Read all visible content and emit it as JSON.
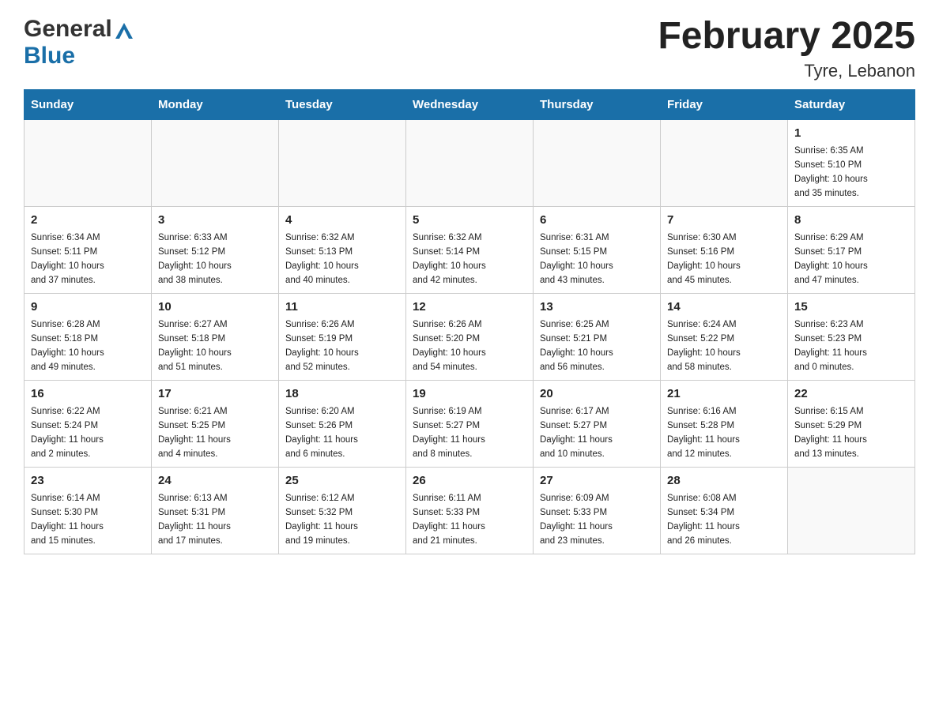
{
  "logo": {
    "general": "General",
    "blue": "Blue"
  },
  "title": "February 2025",
  "subtitle": "Tyre, Lebanon",
  "weekdays": [
    "Sunday",
    "Monday",
    "Tuesday",
    "Wednesday",
    "Thursday",
    "Friday",
    "Saturday"
  ],
  "weeks": [
    [
      {
        "day": "",
        "info": ""
      },
      {
        "day": "",
        "info": ""
      },
      {
        "day": "",
        "info": ""
      },
      {
        "day": "",
        "info": ""
      },
      {
        "day": "",
        "info": ""
      },
      {
        "day": "",
        "info": ""
      },
      {
        "day": "1",
        "info": "Sunrise: 6:35 AM\nSunset: 5:10 PM\nDaylight: 10 hours\nand 35 minutes."
      }
    ],
    [
      {
        "day": "2",
        "info": "Sunrise: 6:34 AM\nSunset: 5:11 PM\nDaylight: 10 hours\nand 37 minutes."
      },
      {
        "day": "3",
        "info": "Sunrise: 6:33 AM\nSunset: 5:12 PM\nDaylight: 10 hours\nand 38 minutes."
      },
      {
        "day": "4",
        "info": "Sunrise: 6:32 AM\nSunset: 5:13 PM\nDaylight: 10 hours\nand 40 minutes."
      },
      {
        "day": "5",
        "info": "Sunrise: 6:32 AM\nSunset: 5:14 PM\nDaylight: 10 hours\nand 42 minutes."
      },
      {
        "day": "6",
        "info": "Sunrise: 6:31 AM\nSunset: 5:15 PM\nDaylight: 10 hours\nand 43 minutes."
      },
      {
        "day": "7",
        "info": "Sunrise: 6:30 AM\nSunset: 5:16 PM\nDaylight: 10 hours\nand 45 minutes."
      },
      {
        "day": "8",
        "info": "Sunrise: 6:29 AM\nSunset: 5:17 PM\nDaylight: 10 hours\nand 47 minutes."
      }
    ],
    [
      {
        "day": "9",
        "info": "Sunrise: 6:28 AM\nSunset: 5:18 PM\nDaylight: 10 hours\nand 49 minutes."
      },
      {
        "day": "10",
        "info": "Sunrise: 6:27 AM\nSunset: 5:18 PM\nDaylight: 10 hours\nand 51 minutes."
      },
      {
        "day": "11",
        "info": "Sunrise: 6:26 AM\nSunset: 5:19 PM\nDaylight: 10 hours\nand 52 minutes."
      },
      {
        "day": "12",
        "info": "Sunrise: 6:26 AM\nSunset: 5:20 PM\nDaylight: 10 hours\nand 54 minutes."
      },
      {
        "day": "13",
        "info": "Sunrise: 6:25 AM\nSunset: 5:21 PM\nDaylight: 10 hours\nand 56 minutes."
      },
      {
        "day": "14",
        "info": "Sunrise: 6:24 AM\nSunset: 5:22 PM\nDaylight: 10 hours\nand 58 minutes."
      },
      {
        "day": "15",
        "info": "Sunrise: 6:23 AM\nSunset: 5:23 PM\nDaylight: 11 hours\nand 0 minutes."
      }
    ],
    [
      {
        "day": "16",
        "info": "Sunrise: 6:22 AM\nSunset: 5:24 PM\nDaylight: 11 hours\nand 2 minutes."
      },
      {
        "day": "17",
        "info": "Sunrise: 6:21 AM\nSunset: 5:25 PM\nDaylight: 11 hours\nand 4 minutes."
      },
      {
        "day": "18",
        "info": "Sunrise: 6:20 AM\nSunset: 5:26 PM\nDaylight: 11 hours\nand 6 minutes."
      },
      {
        "day": "19",
        "info": "Sunrise: 6:19 AM\nSunset: 5:27 PM\nDaylight: 11 hours\nand 8 minutes."
      },
      {
        "day": "20",
        "info": "Sunrise: 6:17 AM\nSunset: 5:27 PM\nDaylight: 11 hours\nand 10 minutes."
      },
      {
        "day": "21",
        "info": "Sunrise: 6:16 AM\nSunset: 5:28 PM\nDaylight: 11 hours\nand 12 minutes."
      },
      {
        "day": "22",
        "info": "Sunrise: 6:15 AM\nSunset: 5:29 PM\nDaylight: 11 hours\nand 13 minutes."
      }
    ],
    [
      {
        "day": "23",
        "info": "Sunrise: 6:14 AM\nSunset: 5:30 PM\nDaylight: 11 hours\nand 15 minutes."
      },
      {
        "day": "24",
        "info": "Sunrise: 6:13 AM\nSunset: 5:31 PM\nDaylight: 11 hours\nand 17 minutes."
      },
      {
        "day": "25",
        "info": "Sunrise: 6:12 AM\nSunset: 5:32 PM\nDaylight: 11 hours\nand 19 minutes."
      },
      {
        "day": "26",
        "info": "Sunrise: 6:11 AM\nSunset: 5:33 PM\nDaylight: 11 hours\nand 21 minutes."
      },
      {
        "day": "27",
        "info": "Sunrise: 6:09 AM\nSunset: 5:33 PM\nDaylight: 11 hours\nand 23 minutes."
      },
      {
        "day": "28",
        "info": "Sunrise: 6:08 AM\nSunset: 5:34 PM\nDaylight: 11 hours\nand 26 minutes."
      },
      {
        "day": "",
        "info": ""
      }
    ]
  ]
}
